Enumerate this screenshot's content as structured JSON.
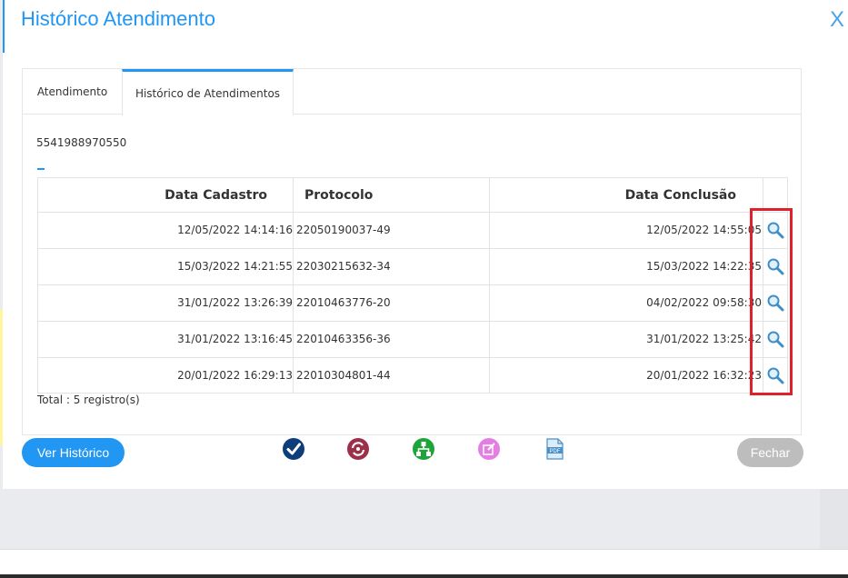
{
  "modal": {
    "title": "Histórico Atendimento",
    "close_label": "X"
  },
  "tabs": [
    {
      "label": "Atendimento"
    },
    {
      "label": "Histórico de Atendimentos"
    }
  ],
  "phone": "5541988970550",
  "table": {
    "headers": {
      "data_cadastro": "Data Cadastro",
      "protocolo": "Protocolo",
      "data_conclusao": "Data Conclusão"
    },
    "rows": [
      {
        "data_cadastro": "12/05/2022 14:14:16",
        "protocolo": "22050190037-49",
        "data_conclusao": "12/05/2022 14:55:05"
      },
      {
        "data_cadastro": "15/03/2022 14:21:55",
        "protocolo": "22030215632-34",
        "data_conclusao": "15/03/2022 14:22:35"
      },
      {
        "data_cadastro": "31/01/2022 13:26:39",
        "protocolo": "22010463776-20",
        "data_conclusao": "04/02/2022 09:58:30"
      },
      {
        "data_cadastro": "31/01/2022 13:16:45",
        "protocolo": "22010463356-36",
        "data_conclusao": "31/01/2022 13:25:42"
      },
      {
        "data_cadastro": "20/01/2022 16:29:13",
        "protocolo": "22010304801-44",
        "data_conclusao": "20/01/2022 16:32:23"
      }
    ],
    "total": "Total : 5 registro(s)"
  },
  "footer": {
    "ver_historico_label": "Ver Histórico",
    "fechar_label": "Fechar",
    "icons": [
      "check-icon",
      "refresh-icon",
      "hierarchy-icon",
      "edit-icon",
      "pdf-icon"
    ]
  },
  "colors": {
    "accent": "#2196f3",
    "highlight": "#e0202a",
    "disabled": "#bdbdbd"
  }
}
